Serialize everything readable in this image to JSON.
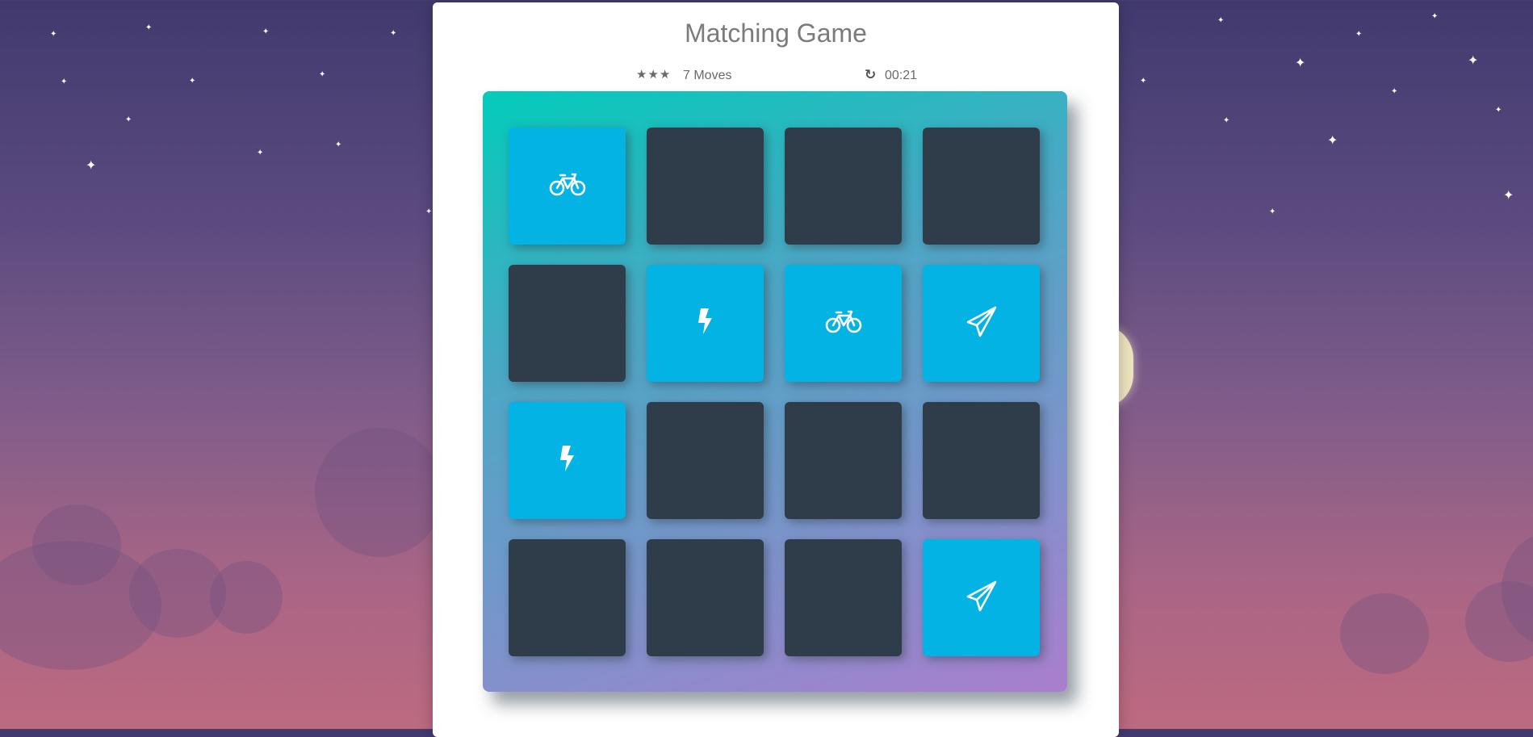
{
  "header": {
    "title": "Matching Game"
  },
  "score_panel": {
    "stars": [
      "star-icon",
      "star-icon",
      "star-icon"
    ],
    "moves_label": "7 Moves",
    "restart_icon": "restart-icon",
    "timer": "00:21"
  },
  "deck": {
    "cards": [
      {
        "state": "open",
        "icon": "bicycle-icon"
      },
      {
        "state": "closed",
        "icon": ""
      },
      {
        "state": "closed",
        "icon": ""
      },
      {
        "state": "closed",
        "icon": ""
      },
      {
        "state": "closed",
        "icon": ""
      },
      {
        "state": "open",
        "icon": "bolt-icon"
      },
      {
        "state": "open",
        "icon": "bicycle-icon"
      },
      {
        "state": "open",
        "icon": "paper-plane-icon"
      },
      {
        "state": "open",
        "icon": "bolt-icon"
      },
      {
        "state": "closed",
        "icon": ""
      },
      {
        "state": "closed",
        "icon": ""
      },
      {
        "state": "closed",
        "icon": ""
      },
      {
        "state": "closed",
        "icon": ""
      },
      {
        "state": "closed",
        "icon": ""
      },
      {
        "state": "closed",
        "icon": ""
      },
      {
        "state": "open",
        "icon": "paper-plane-icon"
      }
    ]
  },
  "colors": {
    "card_closed": "#2e3d49",
    "card_open": "#02b3e4"
  }
}
